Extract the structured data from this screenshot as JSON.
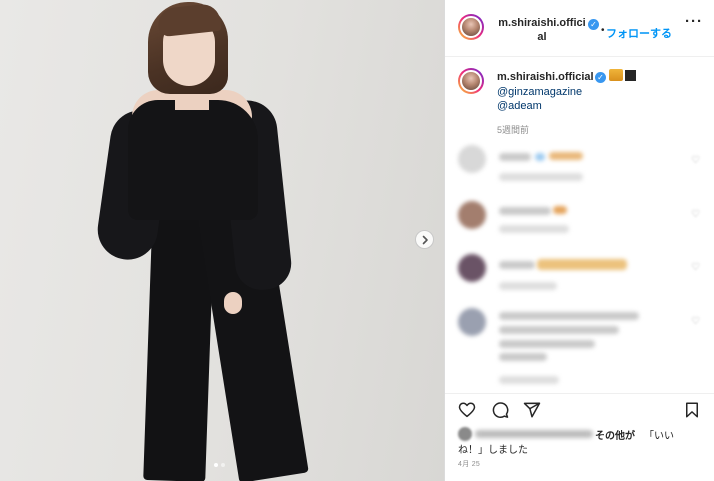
{
  "header": {
    "username": "m.shiraishi.official",
    "separator": "•",
    "follow_label": "フォローする",
    "more_icon": "more-horizontal-icon"
  },
  "caption": {
    "username": "m.shiraishi.official",
    "mentions": [
      "@ginzamagazine",
      "@adeam"
    ],
    "time": "5週間前"
  },
  "carousel": {
    "next_icon": "chevron-right-icon",
    "dot_count": 2,
    "active_dot": 0
  },
  "actions": {
    "like_icon": "heart-icon",
    "comment_icon": "comment-icon",
    "share_icon": "paper-plane-icon",
    "save_icon": "bookmark-icon"
  },
  "likes": {
    "others_label": "その他が",
    "liked_link": "「いい",
    "liked_line2": "ね！」しました"
  },
  "date": "4月 25",
  "colors": {
    "accent": "#0095f6",
    "verified": "#3897f0",
    "mention": "#00376b",
    "muted": "#8e8e8e"
  }
}
